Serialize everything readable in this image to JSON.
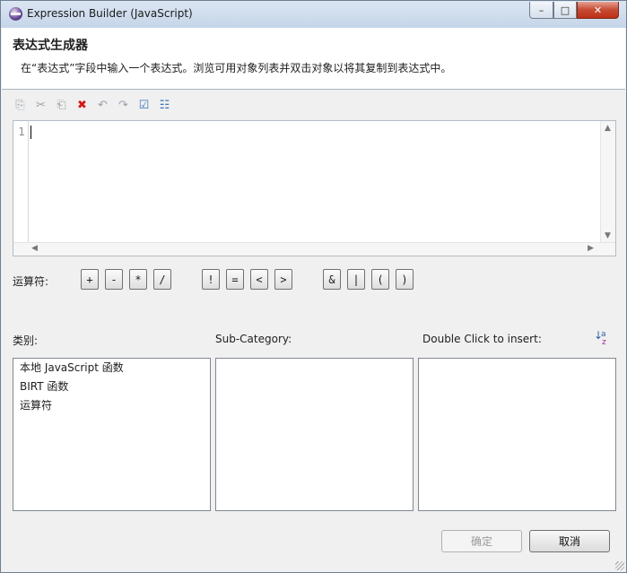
{
  "window": {
    "title": "Expression Builder (JavaScript)",
    "controls": {
      "minimize": "–",
      "maximize": "□",
      "close": "✕"
    }
  },
  "banner": {
    "title": "表达式生成器",
    "description": "在“表达式”字段中输入一个表达式。浏览可用对象列表并双击对象以将其复制到表达式中。"
  },
  "toolbar": [
    {
      "name": "copy-icon",
      "glyph": "⎘",
      "style": ""
    },
    {
      "name": "cut-icon",
      "glyph": "✂",
      "style": ""
    },
    {
      "name": "paste-icon",
      "glyph": "⎗",
      "style": ""
    },
    {
      "name": "delete-icon",
      "glyph": "✖",
      "style": "red"
    },
    {
      "name": "undo-icon",
      "glyph": "↶",
      "style": ""
    },
    {
      "name": "redo-icon",
      "glyph": "↷",
      "style": ""
    },
    {
      "name": "validate-icon",
      "glyph": "☑",
      "style": "blue"
    },
    {
      "name": "calculator-icon",
      "glyph": "☷",
      "style": "blue"
    }
  ],
  "editor": {
    "line_number": "1",
    "content": "",
    "scroll_up": "▲",
    "scroll_down": "▼",
    "scroll_left": "◀",
    "scroll_right": "▶"
  },
  "operators": {
    "label": "运算符:",
    "items": [
      "+",
      "-",
      "*",
      "/",
      "!",
      "=",
      "<",
      ">",
      "&",
      "|",
      "(",
      ")"
    ]
  },
  "lists": {
    "category_label": "类别:",
    "subcategory_label": "Sub-Category:",
    "insert_label": "Double Click to insert:",
    "categories": [
      "本地 JavaScript 函数",
      "BIRT 函数",
      "运算符"
    ],
    "subcategories": [],
    "insert_items": [],
    "sort_icon": {
      "arrow": "↓",
      "a": "a",
      "z": "z"
    }
  },
  "buttons": {
    "ok_label": "确定",
    "cancel_label": "取消"
  }
}
